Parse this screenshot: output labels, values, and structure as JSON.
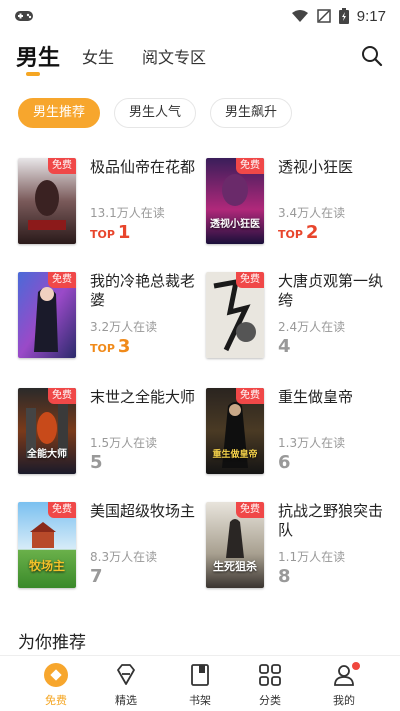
{
  "status_bar": {
    "time": "9:17"
  },
  "top_tabs": [
    {
      "label": "男生"
    },
    {
      "label": "女生"
    },
    {
      "label": "阅文专区"
    }
  ],
  "chips": [
    {
      "label": "男生推荐"
    },
    {
      "label": "男生人气"
    },
    {
      "label": "男生飙升"
    }
  ],
  "books": [
    {
      "title": "极品仙帝在花都",
      "readers": "13.1万人在读",
      "rank_prefix": "TOP",
      "rank": "1",
      "badge": "免费",
      "cover_text": ""
    },
    {
      "title": "透视小狂医",
      "readers": "3.4万人在读",
      "rank_prefix": "TOP",
      "rank": "2",
      "badge": "免费",
      "cover_text": "透视小狂医"
    },
    {
      "title": "我的冷艳总裁老婆",
      "readers": "3.2万人在读",
      "rank_prefix": "TOP",
      "rank": "3",
      "badge": "免费",
      "cover_text": ""
    },
    {
      "title": "大唐贞观第一纨绔",
      "readers": "2.4万人在读",
      "rank_prefix": "",
      "rank": "4",
      "badge": "免费",
      "cover_text": ""
    },
    {
      "title": "末世之全能大师",
      "readers": "1.5万人在读",
      "rank_prefix": "",
      "rank": "5",
      "badge": "免费",
      "cover_text": "全能大师"
    },
    {
      "title": "重生做皇帝",
      "readers": "1.3万人在读",
      "rank_prefix": "",
      "rank": "6",
      "badge": "免费",
      "cover_text": "重生做皇帝"
    },
    {
      "title": "美国超级牧场主",
      "readers": "8.3万人在读",
      "rank_prefix": "",
      "rank": "7",
      "badge": "免费",
      "cover_text": "牧场主"
    },
    {
      "title": "抗战之野狼突击队",
      "readers": "1.1万人在读",
      "rank_prefix": "",
      "rank": "8",
      "badge": "免费",
      "cover_text": "生死狙杀"
    }
  ],
  "section": {
    "title": "为你推荐"
  },
  "bottom_nav": [
    {
      "label": "免费",
      "icon": "free-icon"
    },
    {
      "label": "精选",
      "icon": "diamond-icon"
    },
    {
      "label": "书架",
      "icon": "bookshelf-icon"
    },
    {
      "label": "分类",
      "icon": "grid-icon"
    },
    {
      "label": "我的",
      "icon": "profile-icon"
    }
  ],
  "colors": {
    "accent": "#f5a623",
    "badge": "#f04848",
    "rank_red": "#e8452c"
  }
}
